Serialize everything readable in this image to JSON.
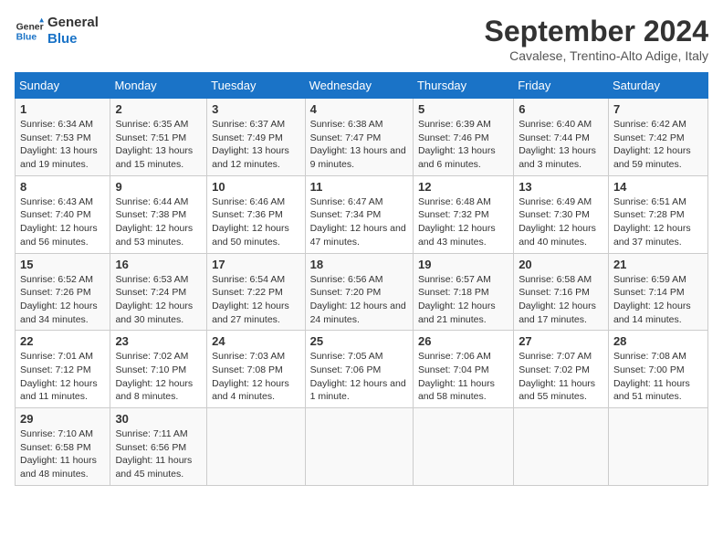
{
  "logo": {
    "line1": "General",
    "line2": "Blue"
  },
  "title": "September 2024",
  "subtitle": "Cavalese, Trentino-Alto Adige, Italy",
  "days_header": [
    "Sunday",
    "Monday",
    "Tuesday",
    "Wednesday",
    "Thursday",
    "Friday",
    "Saturday"
  ],
  "weeks": [
    [
      {
        "day": "1",
        "sunrise": "6:34 AM",
        "sunset": "7:53 PM",
        "daylight": "13 hours and 19 minutes."
      },
      {
        "day": "2",
        "sunrise": "6:35 AM",
        "sunset": "7:51 PM",
        "daylight": "13 hours and 15 minutes."
      },
      {
        "day": "3",
        "sunrise": "6:37 AM",
        "sunset": "7:49 PM",
        "daylight": "13 hours and 12 minutes."
      },
      {
        "day": "4",
        "sunrise": "6:38 AM",
        "sunset": "7:47 PM",
        "daylight": "13 hours and 9 minutes."
      },
      {
        "day": "5",
        "sunrise": "6:39 AM",
        "sunset": "7:46 PM",
        "daylight": "13 hours and 6 minutes."
      },
      {
        "day": "6",
        "sunrise": "6:40 AM",
        "sunset": "7:44 PM",
        "daylight": "13 hours and 3 minutes."
      },
      {
        "day": "7",
        "sunrise": "6:42 AM",
        "sunset": "7:42 PM",
        "daylight": "12 hours and 59 minutes."
      }
    ],
    [
      {
        "day": "8",
        "sunrise": "6:43 AM",
        "sunset": "7:40 PM",
        "daylight": "12 hours and 56 minutes."
      },
      {
        "day": "9",
        "sunrise": "6:44 AM",
        "sunset": "7:38 PM",
        "daylight": "12 hours and 53 minutes."
      },
      {
        "day": "10",
        "sunrise": "6:46 AM",
        "sunset": "7:36 PM",
        "daylight": "12 hours and 50 minutes."
      },
      {
        "day": "11",
        "sunrise": "6:47 AM",
        "sunset": "7:34 PM",
        "daylight": "12 hours and 47 minutes."
      },
      {
        "day": "12",
        "sunrise": "6:48 AM",
        "sunset": "7:32 PM",
        "daylight": "12 hours and 43 minutes."
      },
      {
        "day": "13",
        "sunrise": "6:49 AM",
        "sunset": "7:30 PM",
        "daylight": "12 hours and 40 minutes."
      },
      {
        "day": "14",
        "sunrise": "6:51 AM",
        "sunset": "7:28 PM",
        "daylight": "12 hours and 37 minutes."
      }
    ],
    [
      {
        "day": "15",
        "sunrise": "6:52 AM",
        "sunset": "7:26 PM",
        "daylight": "12 hours and 34 minutes."
      },
      {
        "day": "16",
        "sunrise": "6:53 AM",
        "sunset": "7:24 PM",
        "daylight": "12 hours and 30 minutes."
      },
      {
        "day": "17",
        "sunrise": "6:54 AM",
        "sunset": "7:22 PM",
        "daylight": "12 hours and 27 minutes."
      },
      {
        "day": "18",
        "sunrise": "6:56 AM",
        "sunset": "7:20 PM",
        "daylight": "12 hours and 24 minutes."
      },
      {
        "day": "19",
        "sunrise": "6:57 AM",
        "sunset": "7:18 PM",
        "daylight": "12 hours and 21 minutes."
      },
      {
        "day": "20",
        "sunrise": "6:58 AM",
        "sunset": "7:16 PM",
        "daylight": "12 hours and 17 minutes."
      },
      {
        "day": "21",
        "sunrise": "6:59 AM",
        "sunset": "7:14 PM",
        "daylight": "12 hours and 14 minutes."
      }
    ],
    [
      {
        "day": "22",
        "sunrise": "7:01 AM",
        "sunset": "7:12 PM",
        "daylight": "12 hours and 11 minutes."
      },
      {
        "day": "23",
        "sunrise": "7:02 AM",
        "sunset": "7:10 PM",
        "daylight": "12 hours and 8 minutes."
      },
      {
        "day": "24",
        "sunrise": "7:03 AM",
        "sunset": "7:08 PM",
        "daylight": "12 hours and 4 minutes."
      },
      {
        "day": "25",
        "sunrise": "7:05 AM",
        "sunset": "7:06 PM",
        "daylight": "12 hours and 1 minute."
      },
      {
        "day": "26",
        "sunrise": "7:06 AM",
        "sunset": "7:04 PM",
        "daylight": "11 hours and 58 minutes."
      },
      {
        "day": "27",
        "sunrise": "7:07 AM",
        "sunset": "7:02 PM",
        "daylight": "11 hours and 55 minutes."
      },
      {
        "day": "28",
        "sunrise": "7:08 AM",
        "sunset": "7:00 PM",
        "daylight": "11 hours and 51 minutes."
      }
    ],
    [
      {
        "day": "29",
        "sunrise": "7:10 AM",
        "sunset": "6:58 PM",
        "daylight": "11 hours and 48 minutes."
      },
      {
        "day": "30",
        "sunrise": "7:11 AM",
        "sunset": "6:56 PM",
        "daylight": "11 hours and 45 minutes."
      },
      null,
      null,
      null,
      null,
      null
    ]
  ]
}
